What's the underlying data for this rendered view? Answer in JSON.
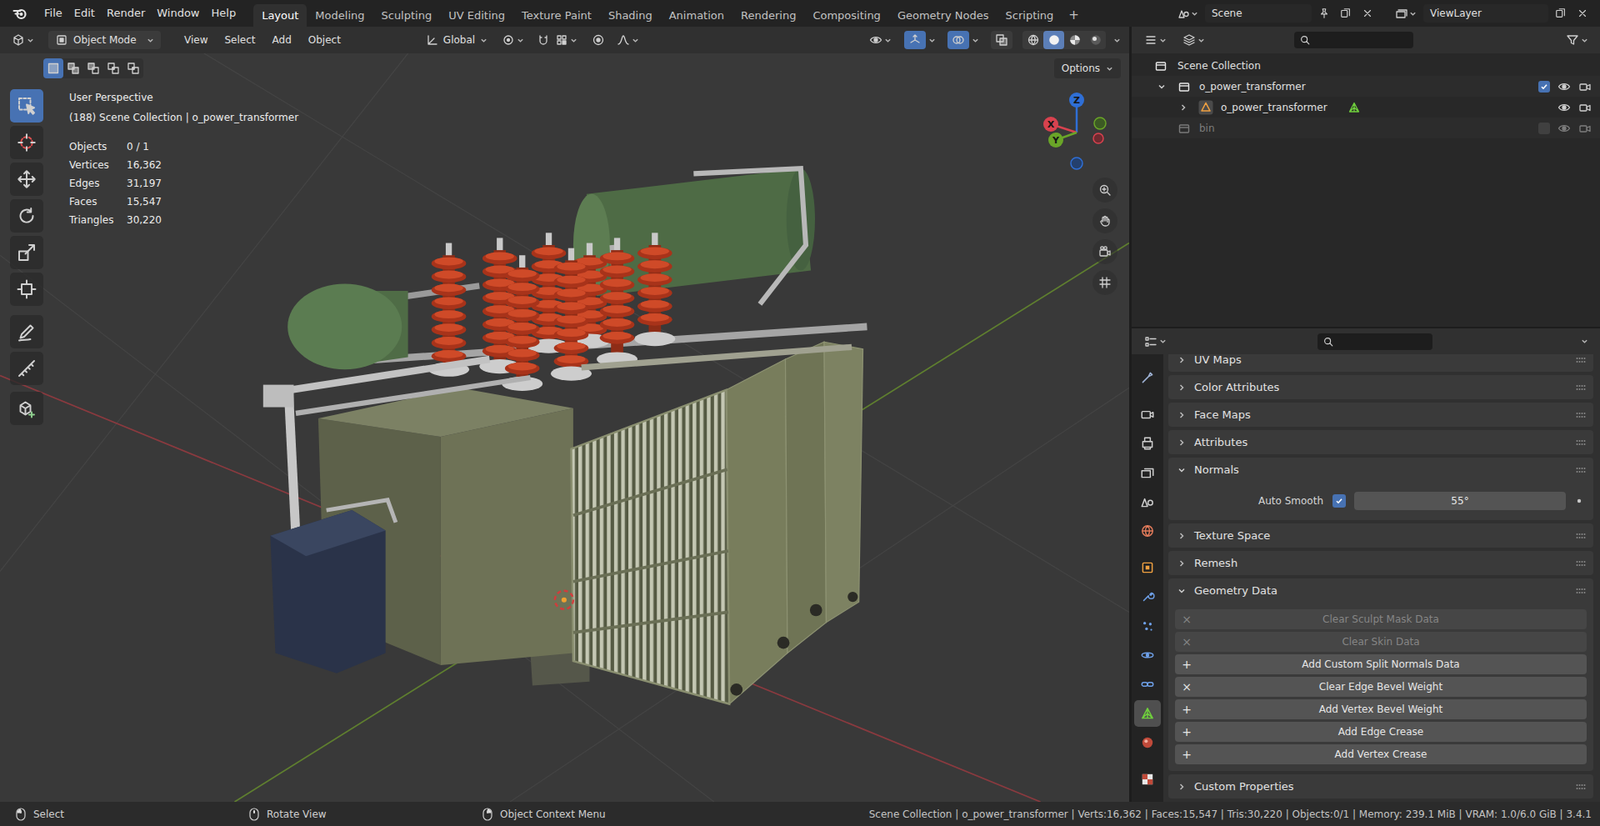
{
  "topbar": {
    "menus": [
      "File",
      "Edit",
      "Render",
      "Window",
      "Help"
    ],
    "workspaces": [
      {
        "label": "Layout",
        "selected": true
      },
      {
        "label": "Modeling",
        "selected": false
      },
      {
        "label": "Sculpting",
        "selected": false
      },
      {
        "label": "UV Editing",
        "selected": false
      },
      {
        "label": "Texture Paint",
        "selected": false
      },
      {
        "label": "Shading",
        "selected": false
      },
      {
        "label": "Animation",
        "selected": false
      },
      {
        "label": "Rendering",
        "selected": false
      },
      {
        "label": "Compositing",
        "selected": false
      },
      {
        "label": "Geometry Nodes",
        "selected": false
      },
      {
        "label": "Scripting",
        "selected": false
      }
    ],
    "add_workspace": "+",
    "scene": "Scene",
    "view_layer": "ViewLayer"
  },
  "viewport": {
    "mode": "Object Mode",
    "menus": [
      "View",
      "Select",
      "Add",
      "Object"
    ],
    "orientation": "Global",
    "toggles": [
      {
        "kind": "gizmo",
        "on": true
      },
      {
        "kind": "overlay",
        "on": true
      },
      {
        "kind": "xray",
        "on": false
      }
    ],
    "shading": [
      {
        "kind": "wireframe",
        "selected": false
      },
      {
        "kind": "solid",
        "selected": true
      },
      {
        "kind": "material",
        "selected": false
      },
      {
        "kind": "rendered",
        "selected": false
      }
    ],
    "select_modes": [
      {
        "kind": "new",
        "selected": true
      },
      {
        "kind": "extend",
        "selected": false
      },
      {
        "kind": "subtract",
        "selected": false
      },
      {
        "kind": "invert",
        "selected": false
      },
      {
        "kind": "intersect",
        "selected": false
      }
    ],
    "options": "Options",
    "perspective": "User Perspective",
    "context": "(188) Scene Collection | o_power_transformer",
    "stats": [
      {
        "label": "Objects",
        "value": "0 / 1"
      },
      {
        "label": "Vertices",
        "value": "16,362"
      },
      {
        "label": "Edges",
        "value": "31,197"
      },
      {
        "label": "Faces",
        "value": "15,547"
      },
      {
        "label": "Triangles",
        "value": "30,220"
      }
    ],
    "gizmo": [
      {
        "label": "Z",
        "color": "#2f6fd6"
      },
      {
        "label": "X",
        "color": "#d8424f"
      },
      {
        "label": "Y",
        "color": "#6aa528"
      }
    ]
  },
  "tools": [
    {
      "kind": "select",
      "selected": true
    },
    {
      "kind": "cursor",
      "selected": false
    },
    {
      "kind": "move",
      "selected": false
    },
    {
      "kind": "rotate",
      "selected": false
    },
    {
      "kind": "scale",
      "selected": false
    },
    {
      "kind": "transform",
      "selected": false
    },
    {
      "kind": "annotate",
      "selected": false
    },
    {
      "kind": "measure",
      "selected": false
    },
    {
      "kind": "add-cube",
      "selected": false
    }
  ],
  "outliner": {
    "items": [
      {
        "label": "Scene Collection",
        "kind": "scene",
        "depth": 0
      },
      {
        "label": "o_power_transformer",
        "kind": "collection",
        "depth": 1,
        "expanded": true,
        "included": true,
        "disabled": false
      },
      {
        "label": "o_power_transformer",
        "kind": "object",
        "depth": 2,
        "expanded": false,
        "disabled": false
      },
      {
        "label": "bin",
        "kind": "collection",
        "depth": 1,
        "included": false,
        "disabled": true
      }
    ]
  },
  "properties": {
    "tabs": [
      {
        "kind": "tool",
        "selected": false
      },
      {
        "kind": "render",
        "selected": false
      },
      {
        "kind": "output",
        "selected": false
      },
      {
        "kind": "view-layer",
        "selected": false
      },
      {
        "kind": "scene",
        "selected": false
      },
      {
        "kind": "world",
        "selected": false
      },
      {
        "kind": "object",
        "selected": false
      },
      {
        "kind": "modifiers",
        "selected": false
      },
      {
        "kind": "particles",
        "selected": false
      },
      {
        "kind": "physics",
        "selected": false
      },
      {
        "kind": "constraints",
        "selected": false
      },
      {
        "kind": "data",
        "selected": true
      },
      {
        "kind": "material",
        "selected": false
      },
      {
        "kind": "texture",
        "selected": false
      }
    ],
    "panels": [
      {
        "title": "UV Maps",
        "expanded": false,
        "kind": "plain"
      },
      {
        "title": "Color Attributes",
        "expanded": false,
        "kind": "plain"
      },
      {
        "title": "Face Maps",
        "expanded": false,
        "kind": "plain"
      },
      {
        "title": "Attributes",
        "expanded": false,
        "kind": "plain"
      },
      {
        "title": "Normals",
        "expanded": true,
        "kind": "normals",
        "rows": [
          {
            "label": "Auto Smooth",
            "checked": true,
            "value": "55°"
          }
        ]
      },
      {
        "title": "Texture Space",
        "expanded": false,
        "kind": "plain"
      },
      {
        "title": "Remesh",
        "expanded": false,
        "kind": "plain"
      },
      {
        "title": "Geometry Data",
        "expanded": true,
        "kind": "buttons",
        "buttons": [
          {
            "label": "Clear Sculpt Mask Data",
            "icon": "×",
            "disabled": true
          },
          {
            "label": "Clear Skin Data",
            "icon": "×",
            "disabled": true
          },
          {
            "label": "Add Custom Split Normals Data",
            "icon": "+",
            "disabled": false
          },
          {
            "label": "Clear Edge Bevel Weight",
            "icon": "×",
            "disabled": false
          },
          {
            "label": "Add Vertex Bevel Weight",
            "icon": "+",
            "disabled": false
          },
          {
            "label": "Add Edge Crease",
            "icon": "+",
            "disabled": false
          },
          {
            "label": "Add Vertex Crease",
            "icon": "+",
            "disabled": false
          }
        ]
      },
      {
        "title": "Custom Properties",
        "expanded": false,
        "kind": "plain"
      }
    ]
  },
  "status_bar": {
    "hints": [
      {
        "label": "Select",
        "kind": "left"
      },
      {
        "label": "Rotate View",
        "kind": "middle"
      },
      {
        "label": "Object Context Menu",
        "kind": "right"
      }
    ],
    "info": "Scene Collection | o_power_transformer | Verts:16,362 | Faces:15,547 | Tris:30,220 | Objects:0/1 | Memory: 239.1 MiB | VRAM: 1.0/6.0 GiB | 3.4.1"
  }
}
